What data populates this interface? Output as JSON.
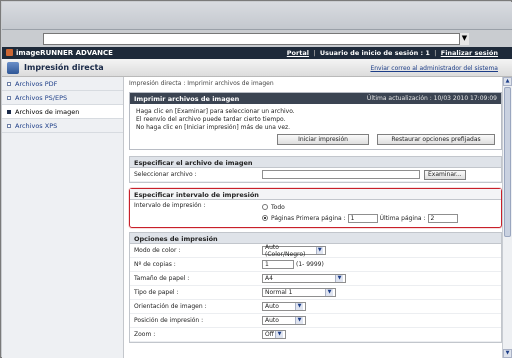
{
  "app": {
    "brand": "imageRUNNER ADVANCE",
    "portal_link": "Portal",
    "user_label": "Usuario de inicio de sesión : 1",
    "logout_link": "Finalizar sesión",
    "page_title": "Impresión directa",
    "admin_link": "Enviar correo al administrador del sistema"
  },
  "sidebar": {
    "items": [
      {
        "label": "Archivos PDF",
        "active": false
      },
      {
        "label": "Archivos PS/EPS",
        "active": false
      },
      {
        "label": "Archivos de imagen",
        "active": true
      },
      {
        "label": "Archivos XPS",
        "active": false
      }
    ]
  },
  "main": {
    "breadcrumb": "Impresión directa : Imprimir archivos de imagen",
    "panel_title": "Imprimir archivos de imagen",
    "last_update": "Última actualización : 10/03 2010 17:09:09",
    "instructions": [
      "Haga clic en [Examinar] para seleccionar un archivo.",
      "El reenvío del archivo puede tardar cierto tiempo.",
      "No haga clic en [Iniciar impresión] más de una vez."
    ],
    "start_print_btn": "Iniciar impresión",
    "restore_btn": "Restaurar opciones prefijadas",
    "file_section_title": "Especificar el archivo de imagen",
    "select_file_label": "Seleccionar archivo :",
    "browse_btn": "Examinar...",
    "range_section_title": "Especificar intervalo de impresión",
    "range_label": "Intervalo de impresión :",
    "range_all": "Todo",
    "range_pages": "Páginas Primera página :",
    "first_page": "1",
    "last_page_label": "Última página :",
    "last_page": "2",
    "options_section_title": "Opciones de impresión",
    "color_mode_label": "Modo de color :",
    "color_mode_value": "Auto (Color/Negro)",
    "copies_label": "Nº de copias :",
    "copies_value": "1",
    "copies_range": "(1- 9999)",
    "paper_size_label": "Tamaño de papel :",
    "paper_size_value": "A4",
    "paper_type_label": "Tipo de papel :",
    "paper_type_value": "Normal 1",
    "orientation_label": "Orientación de imagen :",
    "orientation_value": "Auto",
    "position_label": "Posición de impresión :",
    "position_value": "Auto",
    "zoom_label": "Zoom :",
    "zoom_value": "Off"
  }
}
